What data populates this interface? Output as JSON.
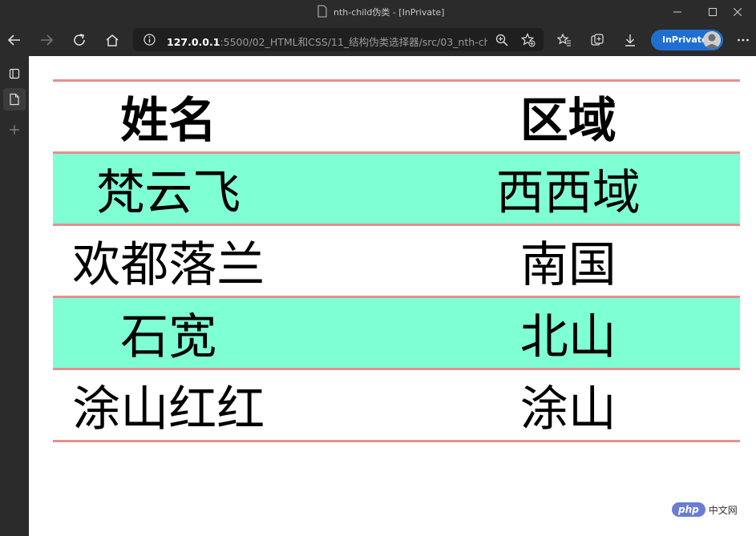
{
  "window": {
    "title": "nth-child伪类 - [InPrivate]"
  },
  "toolbar": {
    "address_host": "127.0.0.1",
    "address_rest": ":5500/02_HTML和CSS/11_结构伪类选择器/src/03_nth-chil...",
    "inprivate_label": "InPrivate"
  },
  "table": {
    "headers": [
      "姓名",
      "区域"
    ],
    "rows": [
      [
        "梵云飞",
        "西西域"
      ],
      [
        "欢都落兰",
        "南国"
      ],
      [
        "石宽",
        "北山"
      ],
      [
        "涂山红红",
        "涂山"
      ]
    ]
  },
  "colors": {
    "row_alt_bg": "#7fffd4",
    "row_border": "#e88e8e",
    "chrome_bg": "#2b2b2b",
    "inprivate_bg": "#1e6fd0"
  },
  "watermark": {
    "logo": "php",
    "text": "中文网"
  }
}
